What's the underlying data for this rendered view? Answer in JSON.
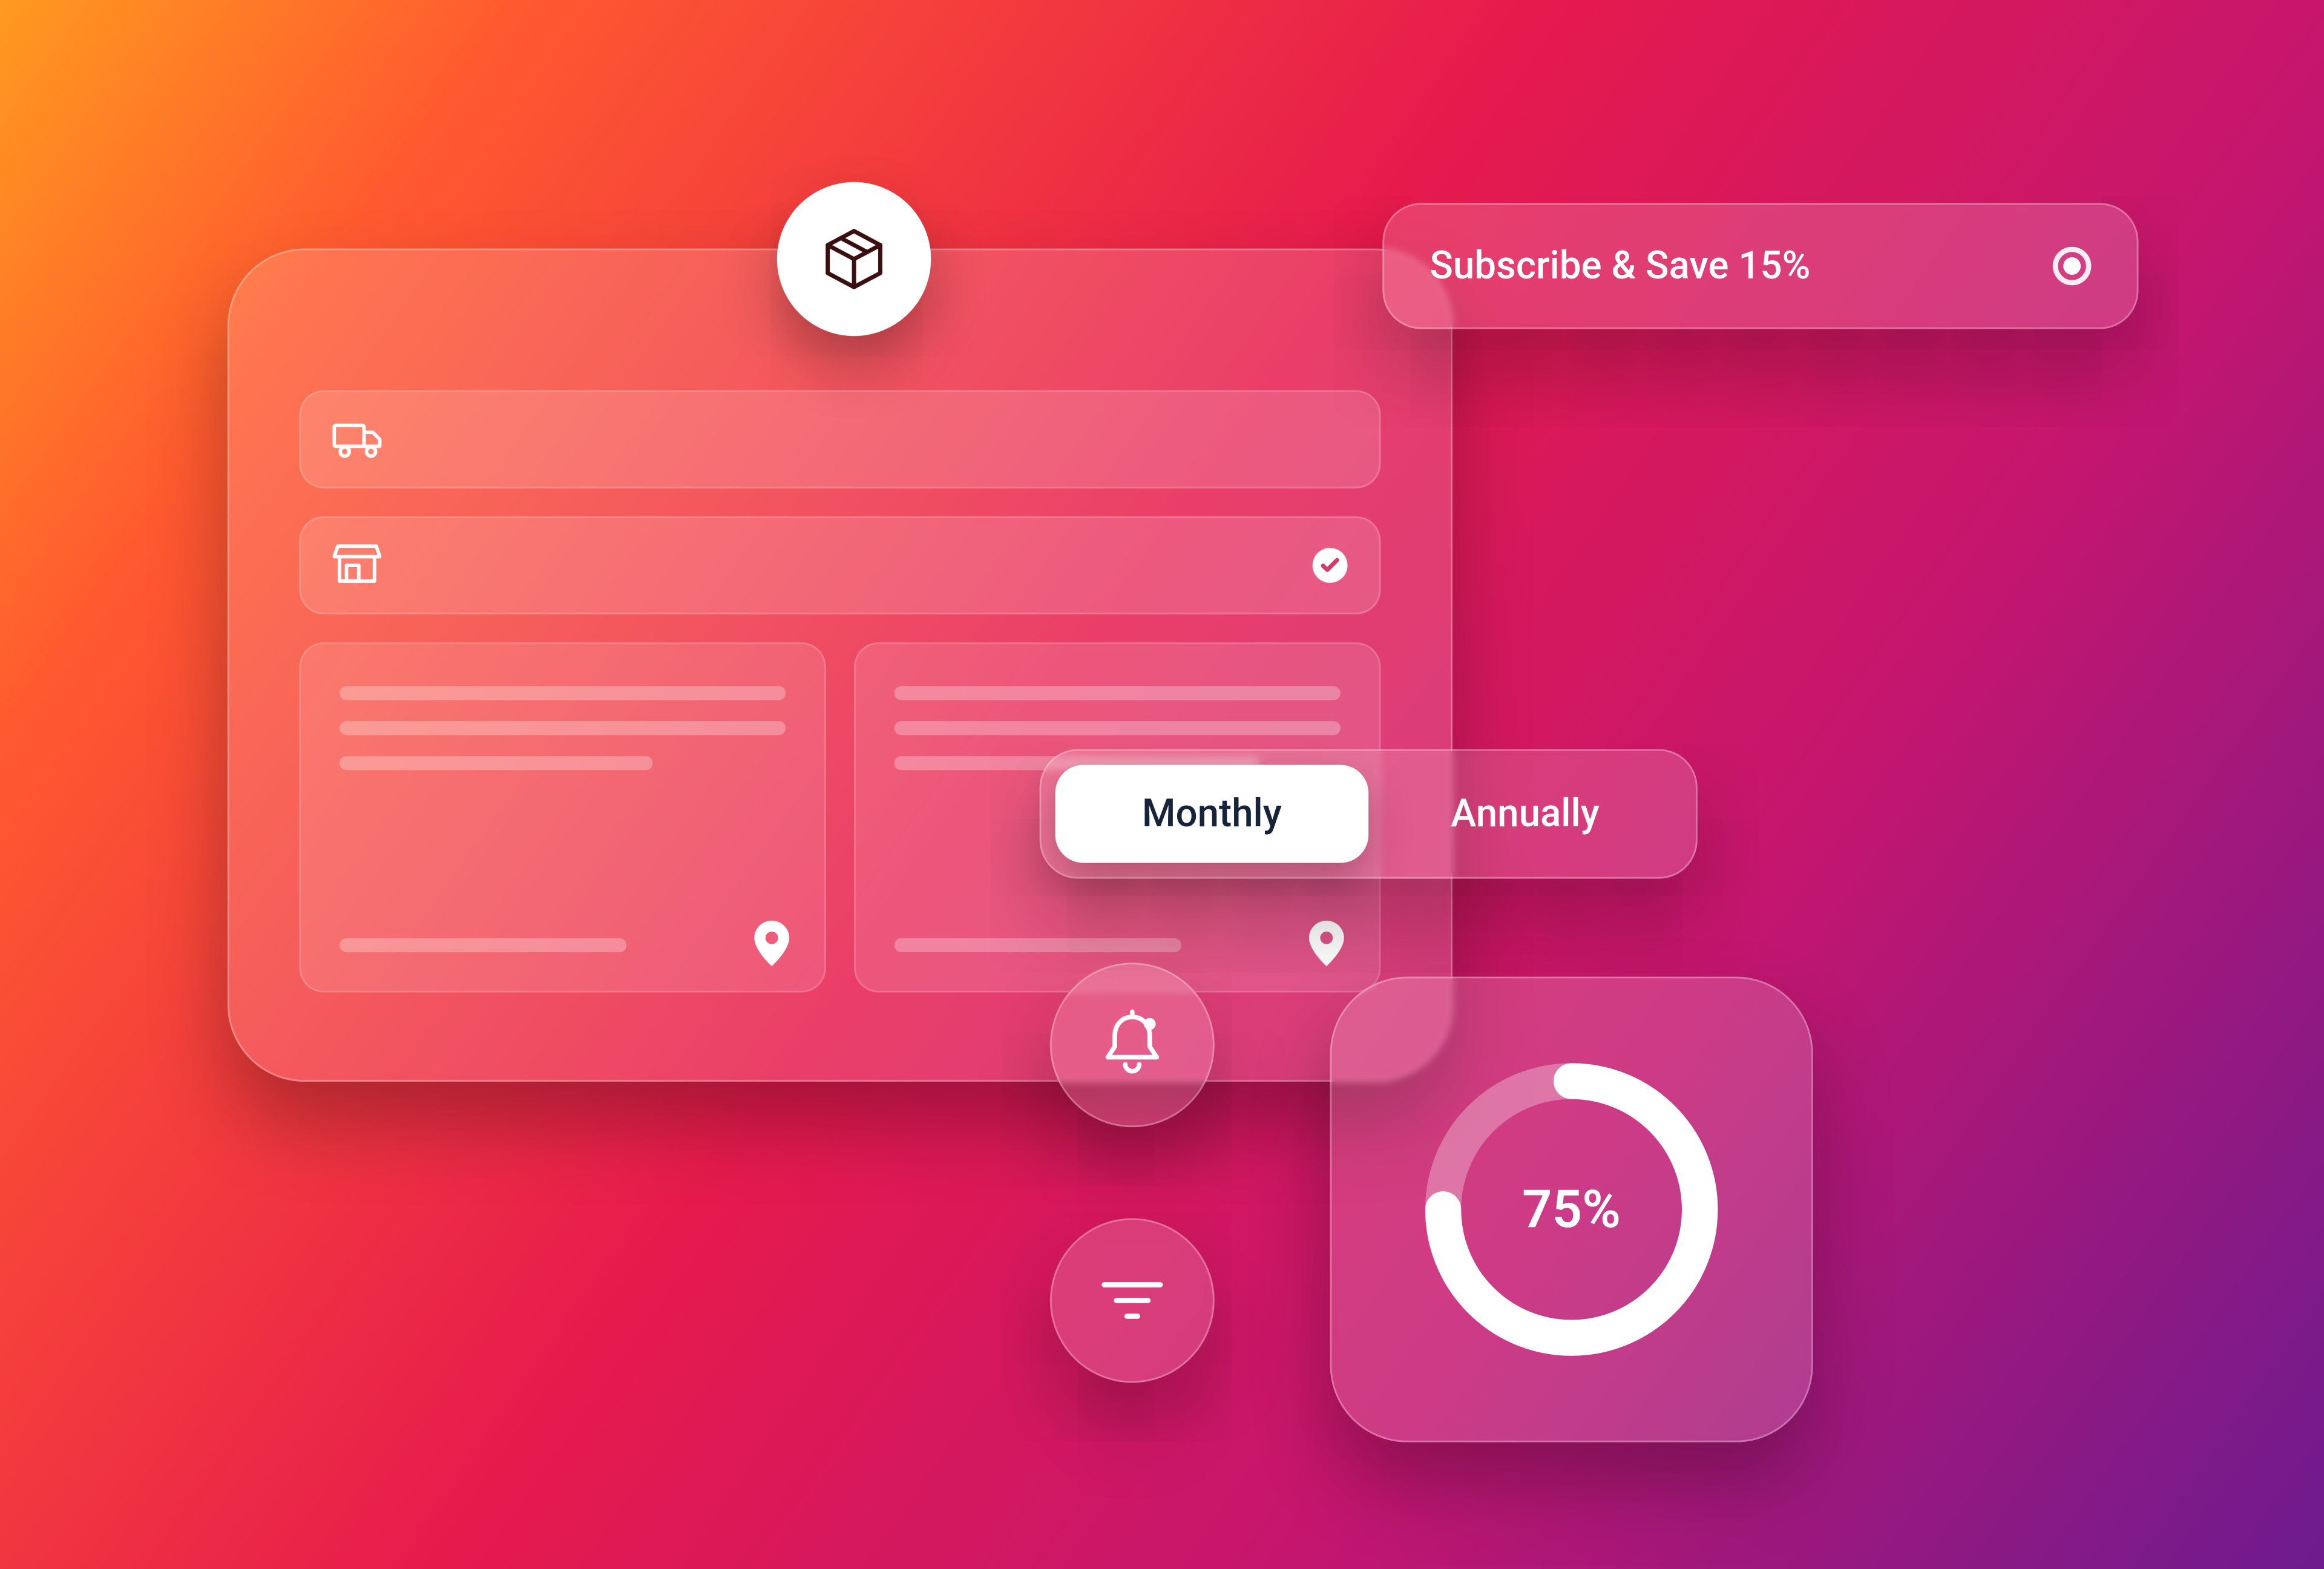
{
  "subscribe": {
    "label": "Subscribe & Save 15%",
    "selected": true
  },
  "toggle": {
    "options": [
      "Monthly",
      "Annually"
    ],
    "active_index": 0
  },
  "progress": {
    "percent": 75,
    "label": "75%"
  },
  "icons": {
    "package": "package-icon",
    "truck": "truck-icon",
    "store": "store-icon",
    "check": "check-icon",
    "pin": "pin-icon",
    "bell": "bell-icon",
    "filter": "filter-icon"
  },
  "chart_data": {
    "type": "pie",
    "title": "",
    "series": [
      {
        "name": "progress",
        "values": [
          75
        ]
      },
      {
        "name": "remaining",
        "values": [
          25
        ]
      }
    ],
    "center_label": "75%"
  }
}
